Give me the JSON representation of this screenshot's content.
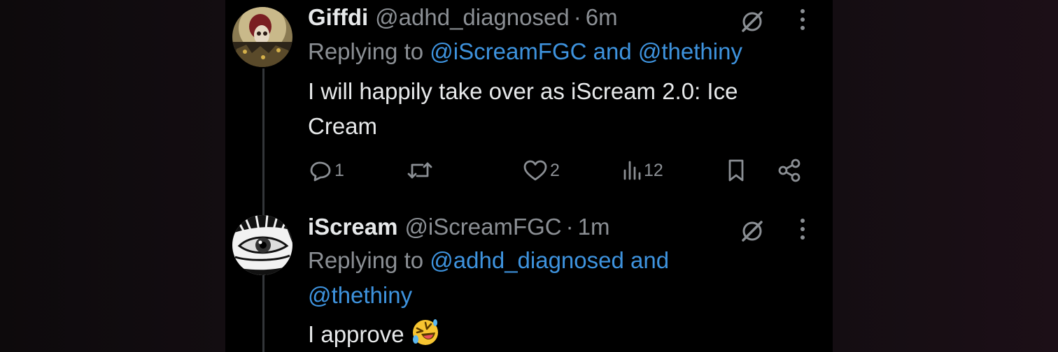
{
  "colors": {
    "background": "#000000",
    "text_primary": "#e7e9ea",
    "text_secondary": "#8b8f94",
    "link": "#3e93de"
  },
  "tweets": [
    {
      "name": "Giffdi",
      "handle": "@adhd_diagnosed",
      "separator": "·",
      "time": "6m",
      "replying_prefix": "Replying to",
      "mention_1": "@iScreamFGC",
      "and_word": "and",
      "mention_2": "@thethiny",
      "text_line_1": "I will happily take over as iScream 2.0: Ice",
      "text_line_2": "Cream",
      "replies": "1",
      "retweets": "",
      "likes": "2",
      "views": "12",
      "icons": [
        "reply-icon",
        "retweet-icon",
        "like-icon",
        "views-icon",
        "bookmark-icon",
        "share-icon",
        "grok-icon",
        "more-icon"
      ]
    },
    {
      "name": "iScream",
      "handle": "@iScreamFGC",
      "separator": "·",
      "time": "1m",
      "replying_prefix": "Replying to",
      "mention_1": "@adhd_diagnosed",
      "and_word": "and",
      "mention_2": "@thethiny",
      "text": "I approve",
      "emoji": "🤣",
      "icons": [
        "grok-icon",
        "more-icon"
      ]
    }
  ]
}
